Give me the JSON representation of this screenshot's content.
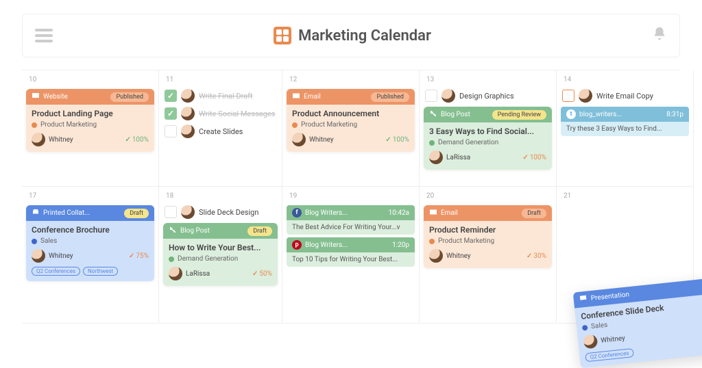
{
  "header": {
    "title": "Marketing Calendar"
  },
  "colors": {
    "orange": "#ed9466",
    "green": "#85bf90",
    "blue": "#5a88e0",
    "red": "#e26a5d",
    "yellow_pill": "#f4e48b"
  },
  "days": [
    {
      "num": "10",
      "cards": [
        {
          "type": "Website",
          "status": "Published",
          "theme": "orange",
          "title": "Product Landing Page",
          "category": "Product Marketing",
          "cat_color": "#e98a4e",
          "assignee": "Whitney",
          "pct": "100%",
          "pct_color": "#6fb47a"
        }
      ]
    },
    {
      "num": "11",
      "tasks": [
        {
          "done": true,
          "label": "Write Final Draft"
        },
        {
          "done": true,
          "label": "Write Social Messages"
        },
        {
          "done": false,
          "label": "Create Slides"
        }
      ]
    },
    {
      "num": "12",
      "cards": [
        {
          "type": "Email",
          "status": "Published",
          "theme": "orange",
          "title": "Product Announcement",
          "category": "Product Marketing",
          "cat_color": "#e98a4e",
          "assignee": "Whitney",
          "pct": "100%",
          "pct_color": "#6fb47a"
        }
      ]
    },
    {
      "num": "13",
      "tasks": [
        {
          "done": false,
          "label": "Design Graphics"
        }
      ],
      "cards": [
        {
          "type": "Blog Post",
          "status": "Pending Review",
          "theme": "green",
          "title": "3 Easy Ways to Find Social...",
          "category": "Demand Generation",
          "cat_color": "#6fb47a",
          "assignee": "LaRissa",
          "pct": "100%",
          "pct_color": "#e98a4e"
        }
      ]
    },
    {
      "num": "14",
      "tasks": [
        {
          "done": false,
          "red": true,
          "label": "Write Email Copy"
        }
      ],
      "social": [
        {
          "net": "tw",
          "label": "blog_writers...",
          "time": "8:31p",
          "text": "Try these 3 Easy Ways to Find..."
        }
      ]
    },
    {
      "num": "17",
      "cards": [
        {
          "type": "Printed Collat...",
          "status": "Draft",
          "theme": "blue",
          "title": "Conference Brochure",
          "category": "Sales",
          "cat_color": "#3e66c7",
          "assignee": "Whitney",
          "pct": "75%",
          "pct_color": "#e98a4e",
          "tags": [
            "Q2 Conferences",
            "Northwest"
          ],
          "tag_color": "#5a88e0"
        }
      ]
    },
    {
      "num": "18",
      "tasks": [
        {
          "done": false,
          "label": "Slide Deck Design"
        }
      ],
      "cards": [
        {
          "type": "Blog Post",
          "status": "Draft",
          "theme": "green",
          "title": "How to Write Your Best...",
          "category": "Demand Generation",
          "cat_color": "#6fb47a",
          "assignee": "LaRissa",
          "pct": "50%",
          "pct_color": "#e98a4e"
        }
      ]
    },
    {
      "num": "19",
      "social": [
        {
          "net": "fb",
          "label": "Blog Writers...",
          "time": "10:42a",
          "text": "The Best Advice For Writing Your...v"
        },
        {
          "net": "pin",
          "label": "Blog Writers...",
          "time": "1:20p",
          "text": "Top 10 Tips for Writing Your Best..."
        }
      ]
    },
    {
      "num": "20",
      "cards": [
        {
          "type": "Email",
          "status": "Draft",
          "theme": "orange",
          "title": "Product Reminder",
          "category": "Product Marketing",
          "cat_color": "#e98a4e",
          "assignee": "Whitney",
          "pct": "30%",
          "pct_color": "#e98a4e"
        }
      ]
    },
    {
      "num": "21",
      "float_card": {
        "type": "Presentation",
        "theme": "blue",
        "title": "Conference Slide Deck",
        "category": "Sales",
        "cat_color": "#3e66c7",
        "assignee": "Whitney",
        "tags": [
          "Q2 Conferences"
        ],
        "tag_color": "#5a88e0"
      }
    }
  ]
}
